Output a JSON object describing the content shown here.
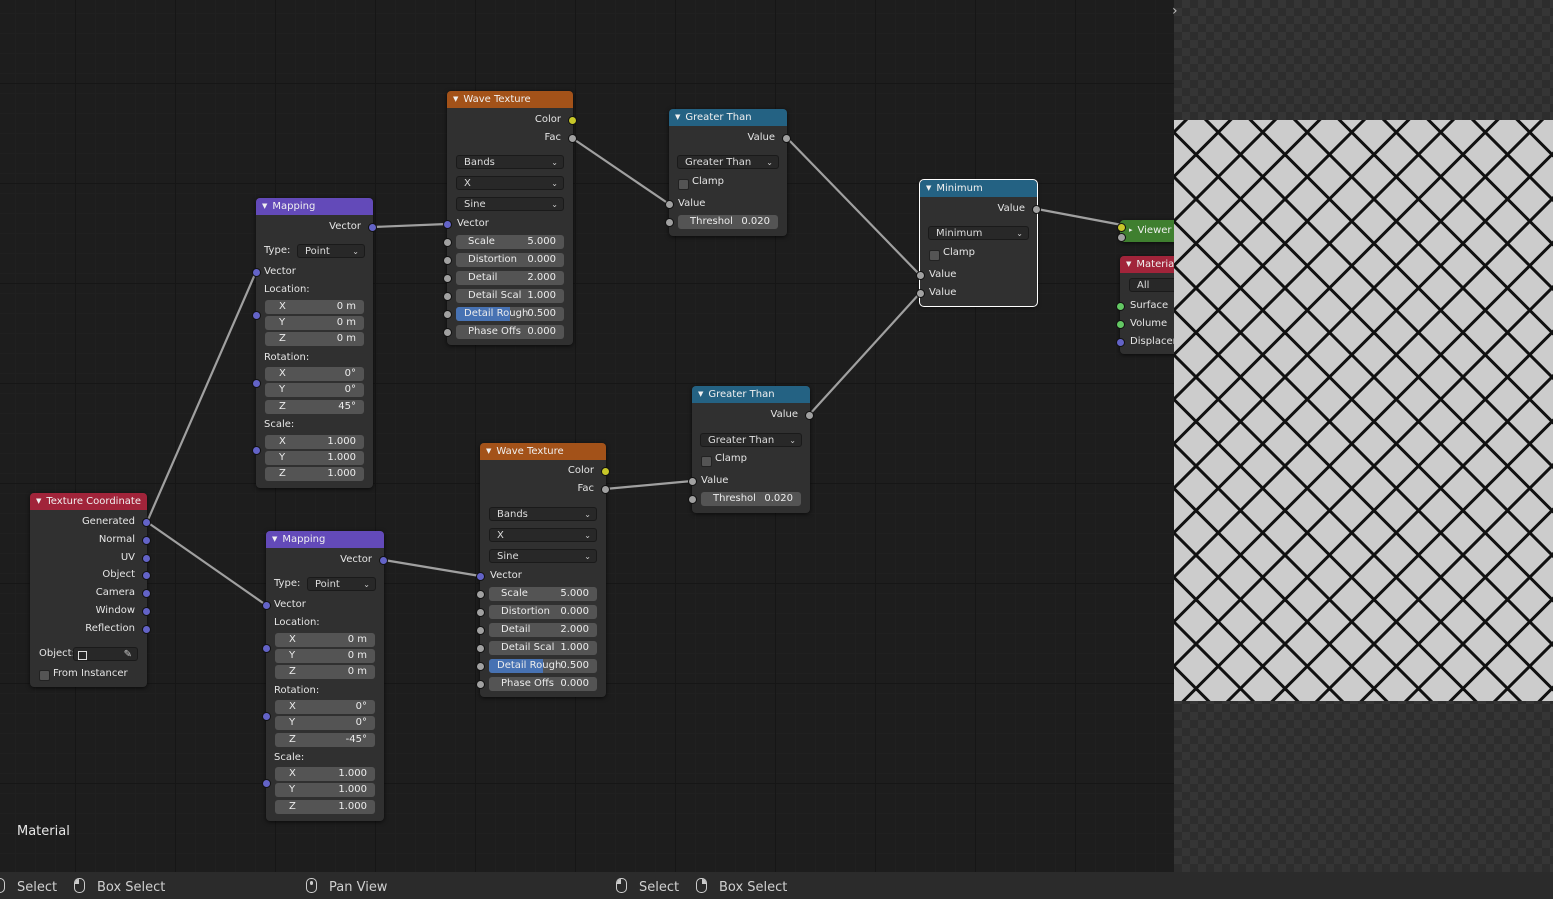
{
  "editor": {
    "tree_label": "Material",
    "sidebar_toggle": "›"
  },
  "nodes": {
    "wave1": {
      "title": "Wave Texture",
      "out_color": "Color",
      "out_fac": "Fac",
      "wave_type": "Bands",
      "direction": "X",
      "profile": "Sine",
      "in_vector": "Vector",
      "scale_label": "Scale",
      "scale": "5.000",
      "distortion_label": "Distortion",
      "distortion": "0.000",
      "detail_label": "Detail",
      "detail": "2.000",
      "detail_scale_label": "Detail Scal",
      "detail_scale": "1.000",
      "detail_rough_label": "Detail Rough",
      "detail_rough": "0.500",
      "detail_rough_fraction": 0.5,
      "phase_label": "Phase Offs",
      "phase": "0.000"
    },
    "wave2": {
      "title": "Wave Texture",
      "out_color": "Color",
      "out_fac": "Fac",
      "wave_type": "Bands",
      "direction": "X",
      "profile": "Sine",
      "in_vector": "Vector",
      "scale_label": "Scale",
      "scale": "5.000",
      "distortion_label": "Distortion",
      "distortion": "0.000",
      "detail_label": "Detail",
      "detail": "2.000",
      "detail_scale_label": "Detail Scal",
      "detail_scale": "1.000",
      "detail_rough_label": "Detail Rough",
      "detail_rough": "0.500",
      "detail_rough_fraction": 0.5,
      "phase_label": "Phase Offs",
      "phase": "0.000"
    },
    "mapping1": {
      "title": "Mapping",
      "out_vector": "Vector",
      "type_label": "Type:",
      "type": "Point",
      "in_vector": "Vector",
      "location_label": "Location:",
      "loc_x": "0 m",
      "loc_y": "0 m",
      "loc_z": "0 m",
      "rotation_label": "Rotation:",
      "rot_x": "0°",
      "rot_y": "0°",
      "rot_z": "45°",
      "scale_label": "Scale:",
      "sc_x": "1.000",
      "sc_y": "1.000",
      "sc_z": "1.000"
    },
    "mapping2": {
      "title": "Mapping",
      "out_vector": "Vector",
      "type_label": "Type:",
      "type": "Point",
      "in_vector": "Vector",
      "location_label": "Location:",
      "loc_x": "0 m",
      "loc_y": "0 m",
      "loc_z": "0 m",
      "rotation_label": "Rotation:",
      "rot_x": "0°",
      "rot_y": "0°",
      "rot_z": "-45°",
      "scale_label": "Scale:",
      "sc_x": "1.000",
      "sc_y": "1.000",
      "sc_z": "1.000"
    },
    "gt1": {
      "title": "Greater Than",
      "out_value": "Value",
      "operation": "Greater Than",
      "clamp": "Clamp",
      "in_value": "Value",
      "threshold_label": "Threshol",
      "threshold": "0.020"
    },
    "gt2": {
      "title": "Greater Than",
      "out_value": "Value",
      "operation": "Greater Than",
      "clamp": "Clamp",
      "in_value": "Value",
      "threshold_label": "Threshol",
      "threshold": "0.020"
    },
    "minimum": {
      "title": "Minimum",
      "out_value": "Value",
      "operation": "Minimum",
      "clamp": "Clamp",
      "in_value1": "Value",
      "in_value2": "Value"
    },
    "texcoord": {
      "title": "Texture Coordinate",
      "outputs": [
        "Generated",
        "Normal",
        "UV",
        "Object",
        "Camera",
        "Window",
        "Reflection"
      ],
      "object_label": "Object:",
      "from_instancer": "From Instancer"
    },
    "viewer": {
      "title": "Viewer"
    },
    "material_output": {
      "title": "Materia",
      "target": "All",
      "inputs": [
        "Surface",
        "Volume",
        "Displacer"
      ]
    }
  },
  "axis": {
    "x": "X",
    "y": "Y",
    "z": "Z"
  },
  "statusbar": {
    "left_select": "Select",
    "left_box_select": "Box Select",
    "pan_view": "Pan View",
    "right_select": "Select",
    "right_box_select": "Box Select"
  },
  "colors": {
    "texture_header": "#a35219",
    "vector_header": "#634ab9",
    "converter_header": "#246283",
    "input_header": "#a1243a",
    "output_header": "#3f7f2f"
  }
}
